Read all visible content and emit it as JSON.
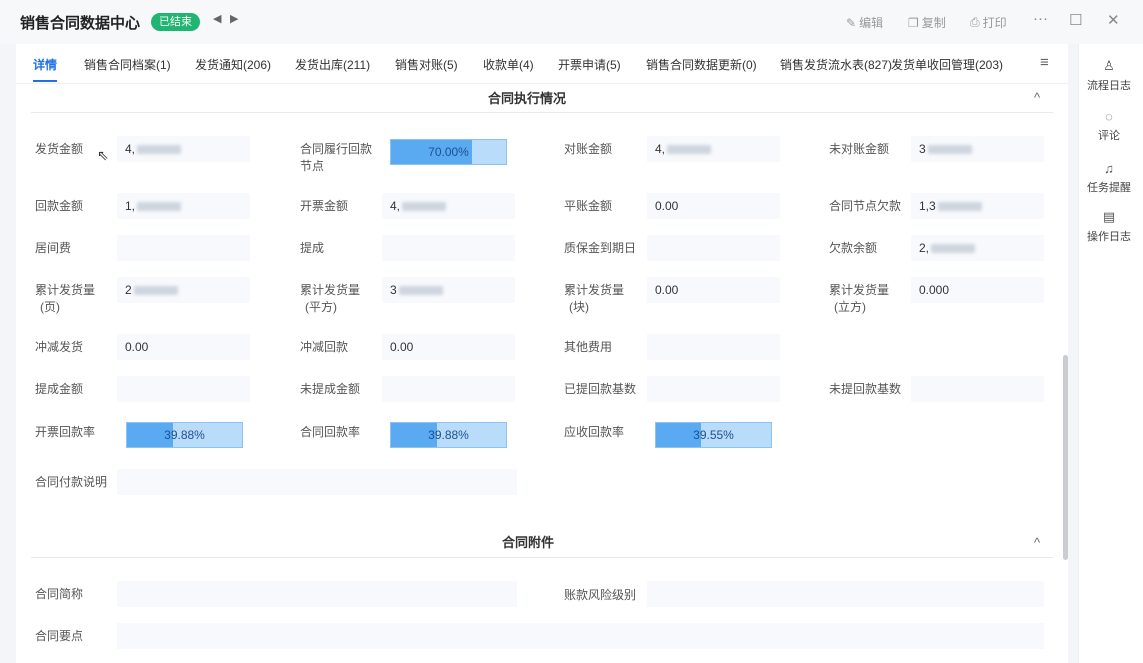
{
  "header": {
    "title": "销售合同数据中心",
    "status": "已结束",
    "prev_icon": "◀",
    "next_icon": "▶",
    "tools": {
      "edit": "编辑",
      "copy": "复制",
      "print": "打印"
    },
    "more": "···",
    "maximize": "☐",
    "close": "✕"
  },
  "tabs": [
    {
      "label": "详情",
      "active": true
    },
    {
      "label": "销售合同档案(1)"
    },
    {
      "label": "发货通知(206)"
    },
    {
      "label": "发货出库(211)"
    },
    {
      "label": "销售对账(5)"
    },
    {
      "label": "收款单(4)"
    },
    {
      "label": "开票申请(5)"
    },
    {
      "label": "销售合同数据更新(0)"
    },
    {
      "label": "销售发货流水表(827)"
    },
    {
      "label": "发货单收回管理(203)"
    }
  ],
  "menu_icon": "≡",
  "section1": {
    "title": "合同执行情况",
    "fields": {
      "ship_amount": {
        "label": "发货金额",
        "value": "4,"
      },
      "perf_node": {
        "label1": "合同履行回款",
        "label2": "节点",
        "percent": 70.0,
        "text": "70.00%"
      },
      "recon_amount": {
        "label": "对账金额",
        "value": "4,"
      },
      "unrecon_amount": {
        "label": "未对账金额",
        "value": "3"
      },
      "return_amount": {
        "label": "回款金额",
        "value": "1,"
      },
      "invoice_amount": {
        "label": "开票金额",
        "value": "4,"
      },
      "balance_amount": {
        "label": "平账金额",
        "value": "0.00"
      },
      "node_arrears": {
        "label": "合同节点欠款",
        "value": "1,3"
      },
      "agency_fee": {
        "label": "居间费",
        "value": ""
      },
      "commission": {
        "label": "提成",
        "value": ""
      },
      "deposit_due": {
        "label": "质保金到期日",
        "value": ""
      },
      "arrears_balance": {
        "label": "欠款余额",
        "value": "2,"
      },
      "cum_pages": {
        "label1": "累计发货量",
        "label2": "(页)",
        "value": "2"
      },
      "cum_sqm": {
        "label1": "累计发货量",
        "label2": "(平方)",
        "value": "3"
      },
      "cum_blocks": {
        "label1": "累计发货量",
        "label2": "(块)",
        "value": "0.00"
      },
      "cum_cubic": {
        "label1": "累计发货量",
        "label2": "(立方)",
        "value": "0.000"
      },
      "offset_ship": {
        "label": "冲减发货",
        "value": "0.00"
      },
      "offset_return": {
        "label": "冲减回款",
        "value": "0.00"
      },
      "other_fee": {
        "label": "其他费用",
        "value": ""
      },
      "commission_amount": {
        "label": "提成金额",
        "value": ""
      },
      "uncommission_amount": {
        "label": "未提成金额",
        "value": ""
      },
      "paid_base": {
        "label": "已提回款基数",
        "value": ""
      },
      "unpaid_base": {
        "label": "未提回款基数",
        "value": ""
      },
      "invoice_rate": {
        "label": "开票回款率",
        "percent": 39.88,
        "text": "39.88%"
      },
      "contract_rate": {
        "label": "合同回款率",
        "percent": 39.88,
        "text": "39.88%"
      },
      "receivable_rate": {
        "label": "应收回款率",
        "percent": 39.55,
        "text": "39.55%"
      },
      "payment_note": {
        "label": "合同付款说明",
        "value": ""
      }
    }
  },
  "section2": {
    "title": "合同附件",
    "fields": {
      "short_name": {
        "label": "合同简称",
        "value": ""
      },
      "risk_level": {
        "label": "账款风险级别",
        "value": ""
      },
      "key_points": {
        "label": "合同要点",
        "value": ""
      }
    }
  },
  "collapse_icon": "^",
  "rightbar": [
    {
      "label": "流程日志",
      "icon": "person-tree-icon"
    },
    {
      "label": "评论",
      "icon": "comment-icon"
    },
    {
      "label": "任务提醒",
      "icon": "bell-icon"
    },
    {
      "label": "操作日志",
      "icon": "log-icon"
    }
  ]
}
